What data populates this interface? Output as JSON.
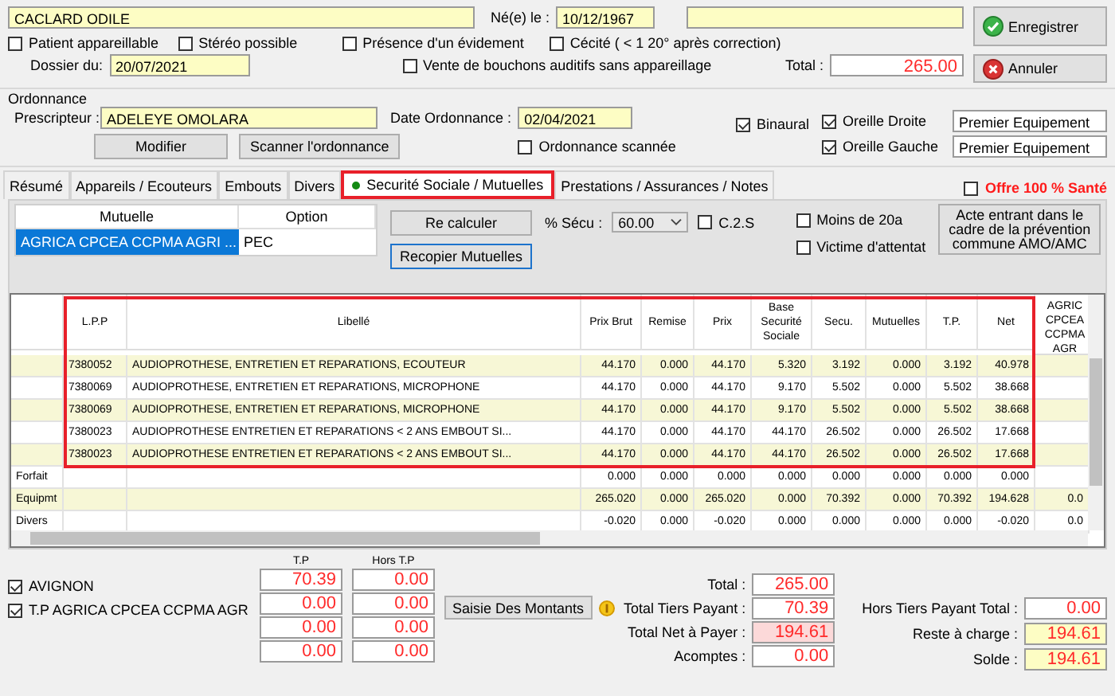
{
  "patient": {
    "name": "CACLARD ODILE",
    "birth_label": "Né(e) le :",
    "birth_date": "10/12/1967"
  },
  "options": [
    {
      "label": "Patient appareillable",
      "checked": false
    },
    {
      "label": "Stéréo possible",
      "checked": false
    },
    {
      "label": "Présence d'un évidement",
      "checked": false
    },
    {
      "label": "Cécité ( < 1 20° après correction)",
      "checked": false
    }
  ],
  "dossier": {
    "label": "Dossier  du:",
    "value": "20/07/2021"
  },
  "vente": {
    "label": "Vente de bouchons auditifs sans appareillage",
    "checked": false
  },
  "total": {
    "label": "Total :",
    "value": "265.00"
  },
  "actions": [
    {
      "label": "Enregistrer",
      "kind": "save"
    },
    {
      "label": "Annuler",
      "kind": "cancel"
    }
  ],
  "ordonnance": {
    "title": "Ordonnance",
    "prescripteur_label": "Prescripteur :",
    "prescripteur": "ADELEYE OMOLARA",
    "date_label": "Date Ordonnance :",
    "date": "02/04/2021",
    "buttons": [
      "Modifier",
      "Scanner l'ordonnance"
    ],
    "scanned": {
      "label": "Ordonnance scannée",
      "checked": false
    }
  },
  "ears": {
    "binaural": {
      "label": "Binaural",
      "checked": true
    },
    "sides": [
      {
        "label": "Oreille Droite",
        "checked": true,
        "value": "Premier Equipement"
      },
      {
        "label": "Oreille Gauche",
        "checked": true,
        "value": "Premier Equipement"
      }
    ]
  },
  "tabs": [
    {
      "label": "Résumé",
      "selected": false
    },
    {
      "label": "Appareils / Ecouteurs",
      "selected": false
    },
    {
      "label": "Embouts",
      "selected": false
    },
    {
      "label": "Divers",
      "selected": false
    },
    {
      "label": "Securité Sociale / Mutuelles",
      "selected": true
    },
    {
      "label": "Prestations / Assurances / Notes",
      "selected": false
    }
  ],
  "offre": {
    "label": "Offre 100 % Santé",
    "checked": false
  },
  "mutuelles": {
    "columns": [
      "Mutuelle",
      "Option"
    ],
    "rows": [
      {
        "mutuelle": "AGRICA CPCEA CCPMA AGRI ...",
        "option": "PEC",
        "selected": true
      }
    ]
  },
  "recalc_button": "Re calculer",
  "copy_button": "Recopier Mutuelles",
  "secu": {
    "label": "% Sécu :",
    "value": "60.00"
  },
  "c2s": {
    "label": "C.2.S",
    "checked": false
  },
  "flags": [
    {
      "label": "Moins de 20a",
      "checked": false
    },
    {
      "label": "Victime d'attentat",
      "checked": false
    }
  ],
  "prevention_button": "Acte entrant dans le cadre de la prévention commune AMO/AMC",
  "table": {
    "outlined": true,
    "columns": [
      "L.P.P",
      "Libellé",
      "Prix Brut",
      "Remise",
      "Prix",
      "Base Securité Sociale",
      "Secu.",
      "Mutuelles",
      "T.P.",
      "Net",
      "AGRIC CPCEA CCPMA AGR"
    ],
    "rows": [
      {
        "cells": [
          "7380052",
          "AUDIOPROTHESE, ENTRETIEN ET REPARATIONS, ECOUTEUR",
          "44.170",
          "0.000",
          "44.170",
          "5.320",
          "3.192",
          "0.000",
          "3.192",
          "40.978"
        ]
      },
      {
        "cells": [
          "7380069",
          "AUDIOPROTHESE, ENTRETIEN ET REPARATIONS, MICROPHONE",
          "44.170",
          "0.000",
          "44.170",
          "9.170",
          "5.502",
          "0.000",
          "5.502",
          "38.668"
        ]
      },
      {
        "cells": [
          "7380069",
          "AUDIOPROTHESE, ENTRETIEN ET REPARATIONS, MICROPHONE",
          "44.170",
          "0.000",
          "44.170",
          "9.170",
          "5.502",
          "0.000",
          "5.502",
          "38.668"
        ]
      },
      {
        "cells": [
          "7380023",
          "AUDIOPROTHESE  ENTRETIEN ET REPARATIONS  < 2 ANS  EMBOUT SI...",
          "44.170",
          "0.000",
          "44.170",
          "44.170",
          "26.502",
          "0.000",
          "26.502",
          "17.668"
        ]
      },
      {
        "cells": [
          "7380023",
          "AUDIOPROTHESE  ENTRETIEN ET REPARATIONS  < 2 ANS  EMBOUT SI...",
          "44.170",
          "0.000",
          "44.170",
          "44.170",
          "26.502",
          "0.000",
          "26.502",
          "17.668"
        ]
      }
    ],
    "summary_rows": [
      {
        "label": "Forfait",
        "cells": [
          "0.000",
          "0.000",
          "0.000",
          "0.000",
          "0.000",
          "0.000",
          "0.000",
          "0.000"
        ]
      },
      {
        "label": "Equipmt",
        "cells": [
          "265.020",
          "0.000",
          "265.020",
          "0.000",
          "70.392",
          "0.000",
          "70.392",
          "194.628",
          "0.0"
        ]
      },
      {
        "label": "Divers",
        "cells": [
          "-0.020",
          "0.000",
          "-0.020",
          "0.000",
          "0.000",
          "0.000",
          "0.000",
          "-0.020",
          "0.0"
        ]
      }
    ]
  },
  "tiers": {
    "tp_label": "T.P",
    "hors_label": "Hors T.P",
    "payers": [
      {
        "label": "AVIGNON",
        "checked": true
      },
      {
        "label": "T.P AGRICA CPCEA CCPMA AGR",
        "checked": true
      }
    ],
    "tp_values": [
      "70.39",
      "0.00",
      "0.00",
      "0.00"
    ],
    "hors_values": [
      "0.00",
      "0.00",
      "0.00",
      "0.00"
    ],
    "saisie_button": "Saisie Des Montants"
  },
  "totals_left": [
    {
      "label": "Total :",
      "value": "265.00",
      "kind": "plain"
    },
    {
      "label": "Total Tiers Payant :",
      "value": "70.39",
      "kind": "plain"
    },
    {
      "label": "Total Net à Payer :",
      "value": "194.61",
      "kind": "due"
    },
    {
      "label": "Acomptes :",
      "value": "0.00",
      "kind": "plain"
    }
  ],
  "totals_right": [
    {
      "label": "Hors Tiers Payant Total :",
      "value": "0.00",
      "kind": "plain"
    },
    {
      "label": "Reste à charge :",
      "value": "194.61",
      "kind": "balance"
    },
    {
      "label": "Solde :",
      "value": "194.61",
      "kind": "balance"
    }
  ]
}
